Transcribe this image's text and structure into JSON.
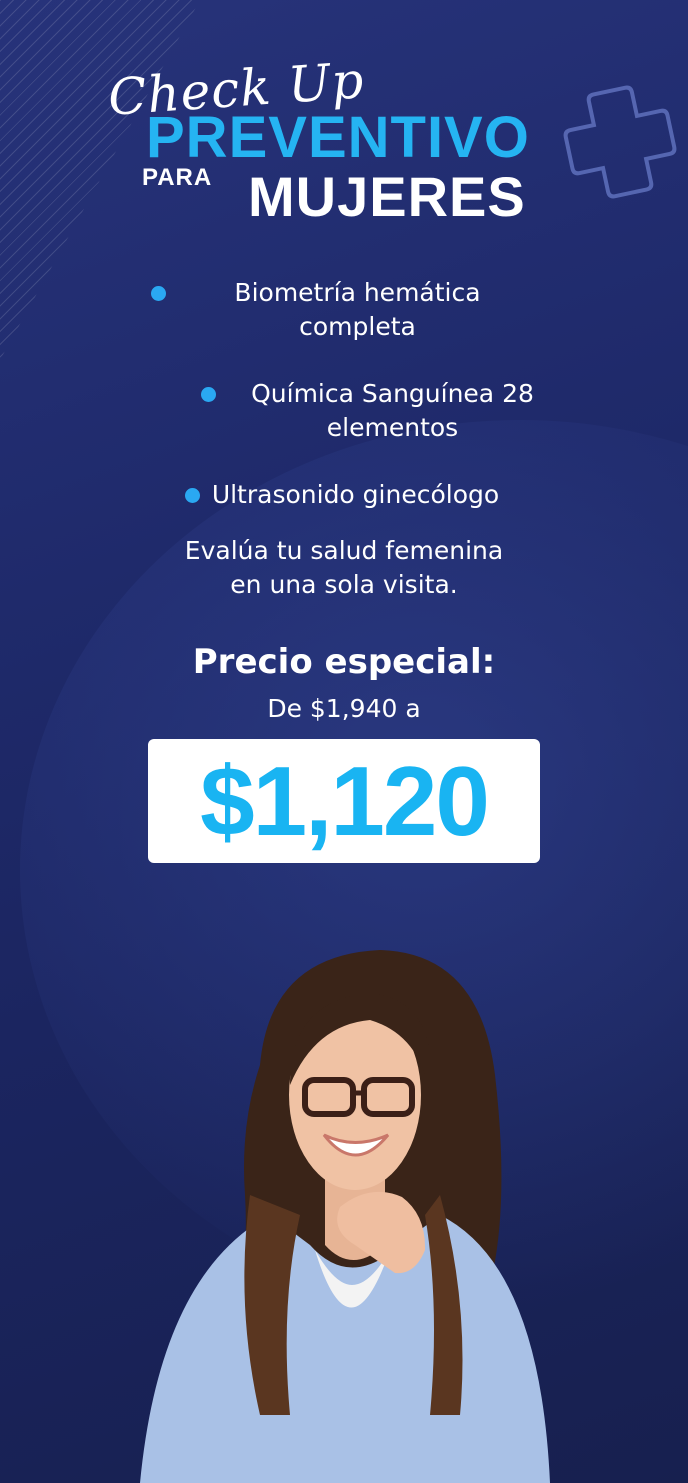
{
  "title": {
    "script_line": "Check Up",
    "line_one": "PREVENTIVO",
    "line_two_small": "PARA",
    "line_two_large": "MUJERES"
  },
  "bullets": [
    {
      "text": "Biometría hemática completa"
    },
    {
      "text": "Química Sanguínea 28 elementos"
    },
    {
      "text": "Ultrasonido ginecólogo"
    }
  ],
  "tagline": {
    "line_one": "Evalúa tu salud femenina",
    "line_two": "en una sola visita."
  },
  "pricing": {
    "heading": "Precio especial:",
    "from_text": "De $1,940 a",
    "price": "$1,120"
  },
  "colors": {
    "background": "#1f2a6b",
    "accent": "#25b4f2",
    "price_box": "#ffffff"
  },
  "icons": [
    "plus-cross-outline-icon",
    "bullet-dot-icon"
  ]
}
